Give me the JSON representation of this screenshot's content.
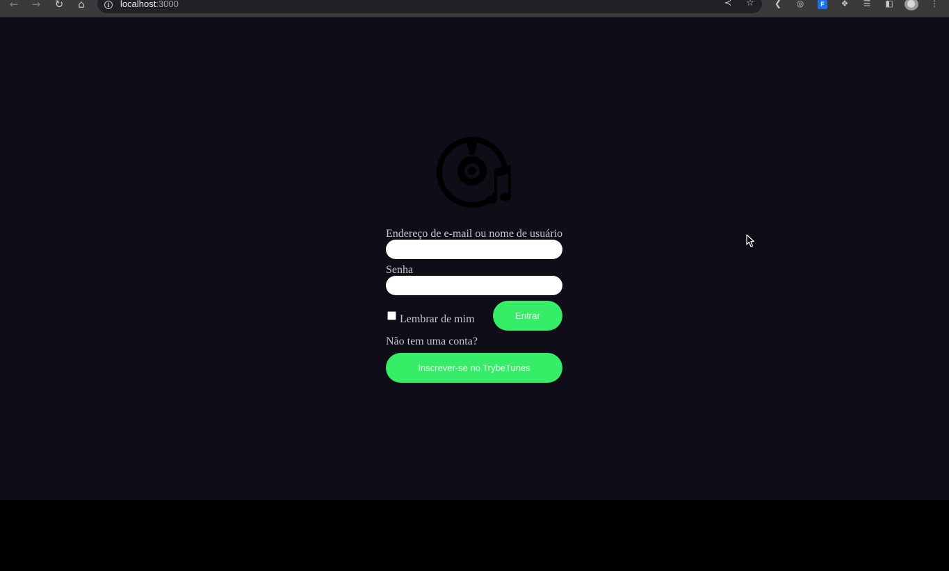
{
  "browser": {
    "url_host": "localhost",
    "url_port": ":3000",
    "icons": {
      "back": "arrow-left-icon",
      "forward": "arrow-right-icon",
      "reload": "reload-icon",
      "home": "home-icon",
      "site_info": "info-icon",
      "share": "share-icon",
      "bookmark": "star-icon",
      "extensions": [
        "extension-arrow-icon",
        "extension-target-icon",
        "extension-badge-icon",
        "puzzle-icon",
        "media-queue-icon",
        "side-panel-icon"
      ],
      "menu": "kebab-menu-icon"
    },
    "extension_badge_text": "F"
  },
  "login": {
    "logo_icon": "music-disc-icon",
    "email_label": "Endereço de e-mail ou nome de usuário",
    "email_value": "",
    "password_label": "Senha",
    "password_value": "",
    "remember_label": "Lembrar de mim",
    "remember_checked": false,
    "submit_label": "Entrar",
    "no_account_text": "Não tem uma conta?",
    "signup_label": "Inscrever-se no TrybeTunes"
  },
  "colors": {
    "page_background": "#0e0d18",
    "accent_green": "#35ed66",
    "label_text": "#c6c5cf",
    "logo": "#000000"
  }
}
